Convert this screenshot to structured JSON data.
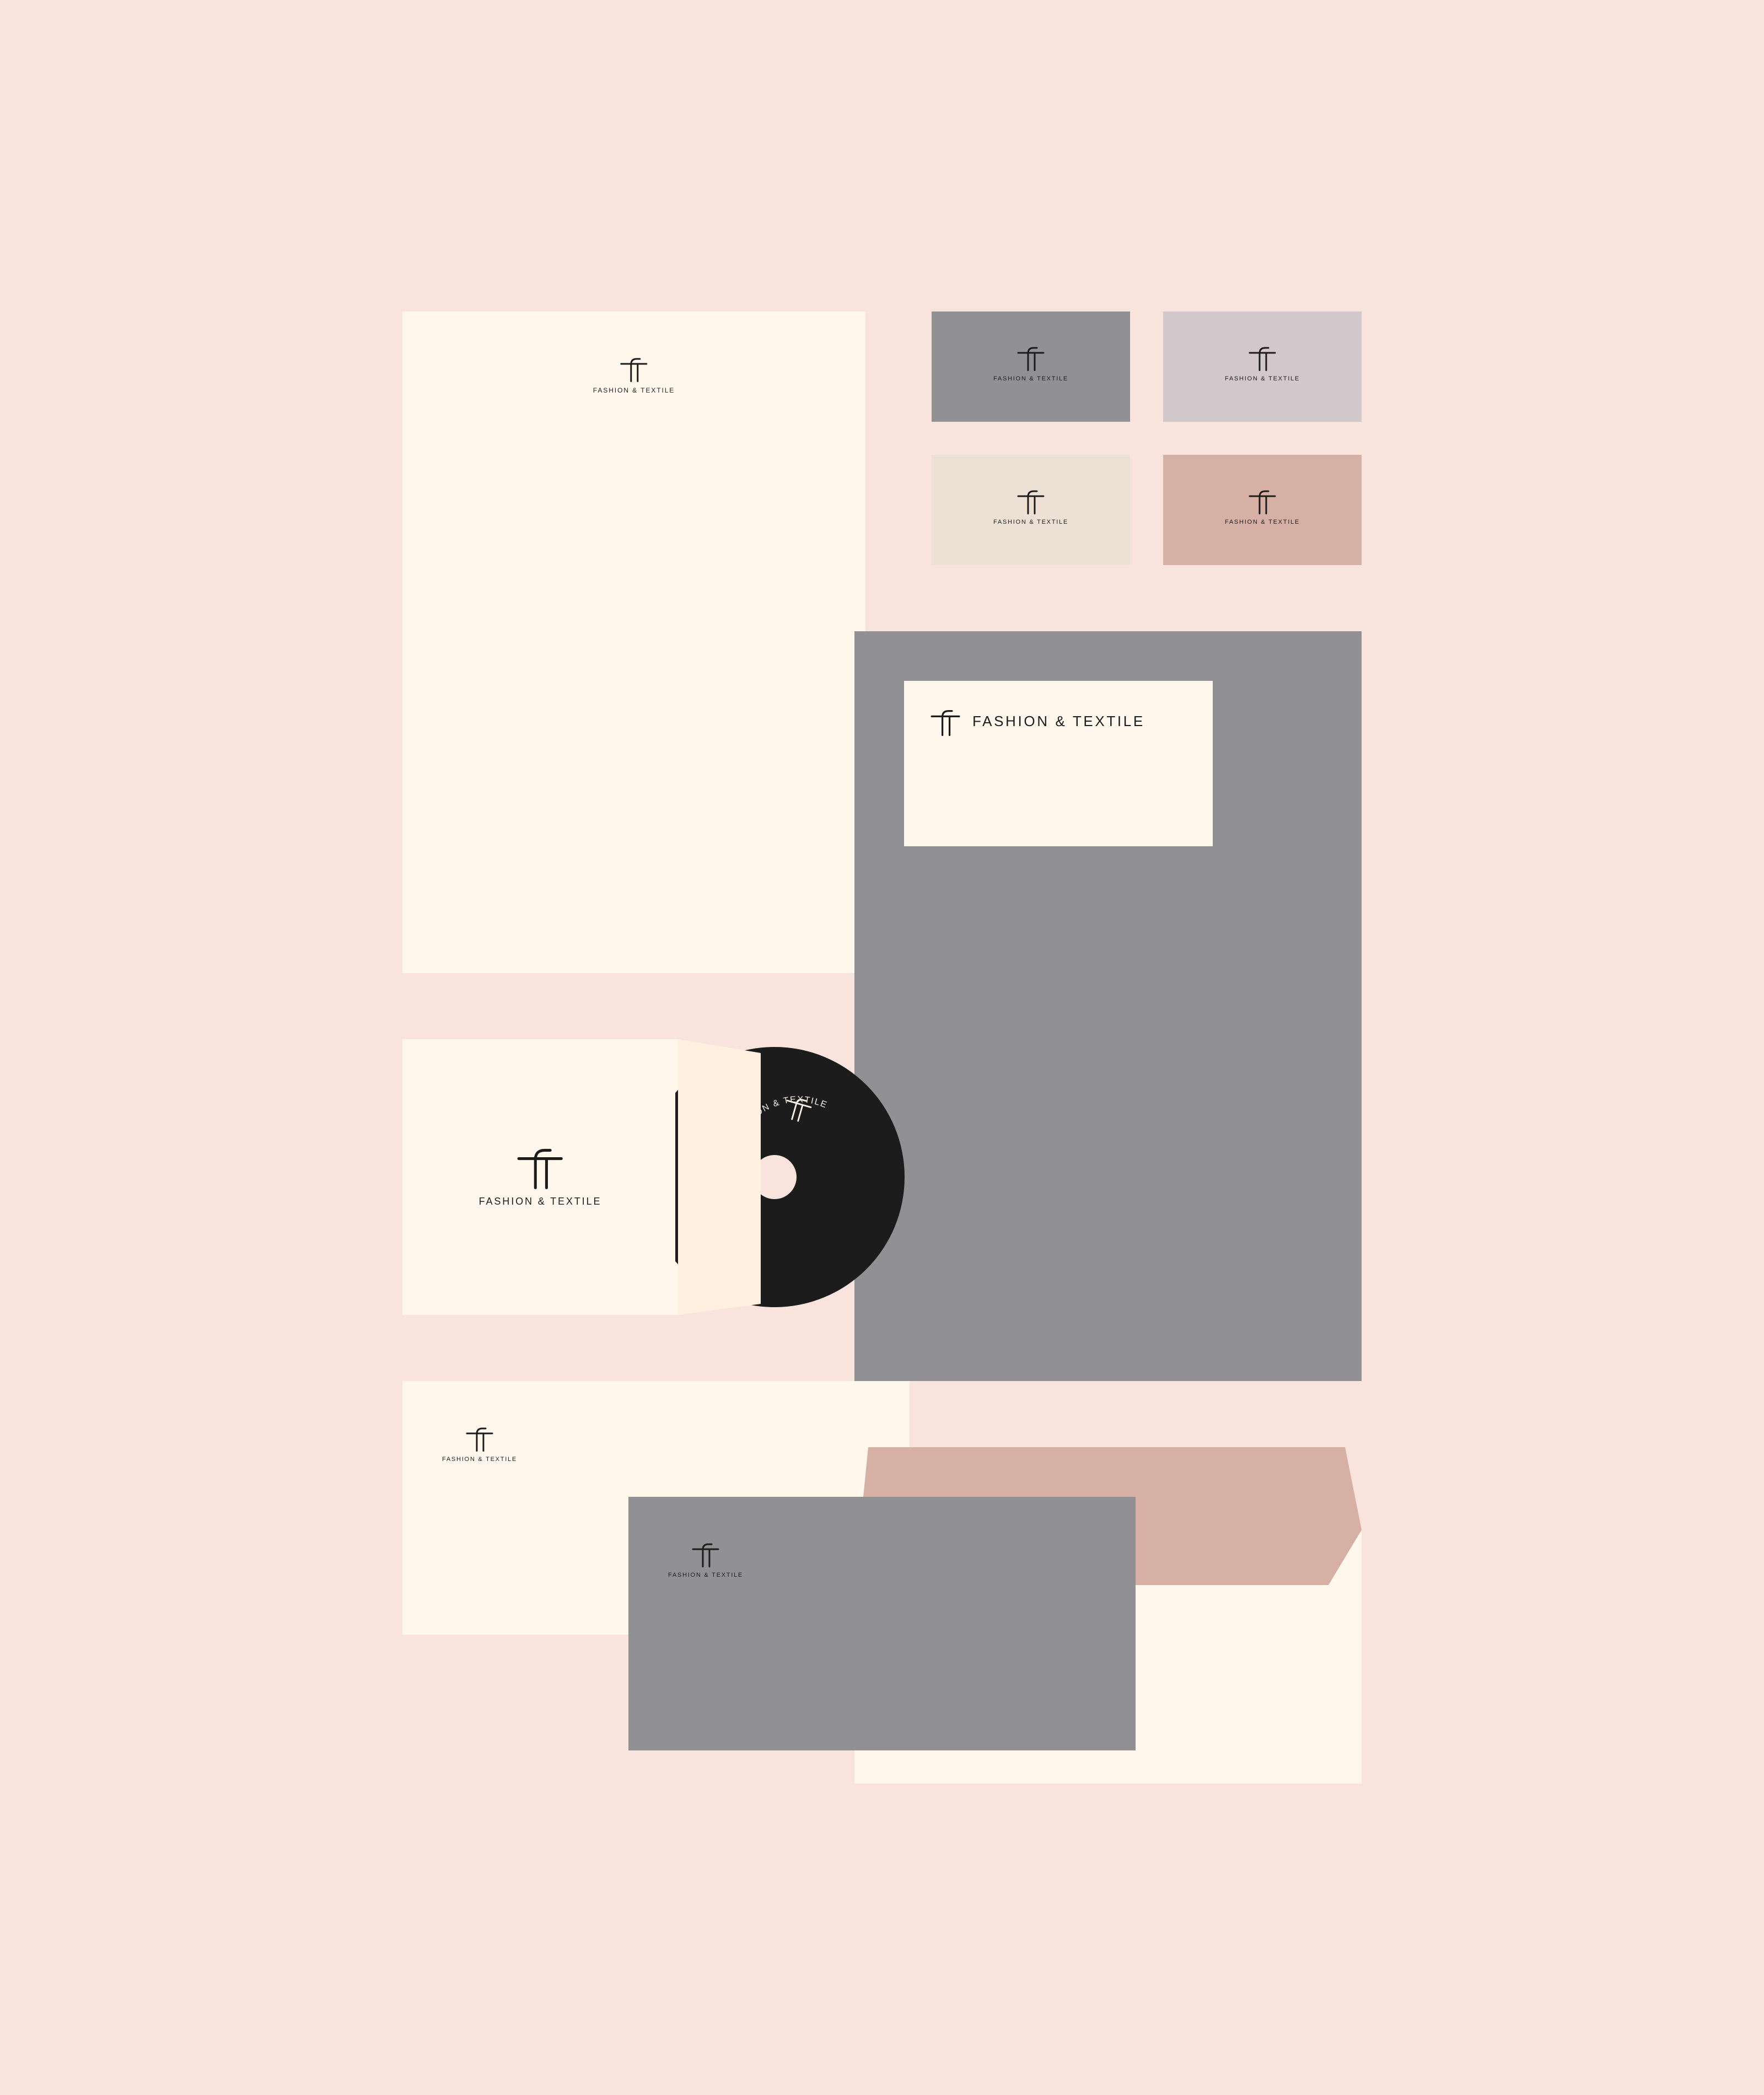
{
  "brand": {
    "name": "FASHION & TEXTILE",
    "monogram_name": "ft-monogram-icon"
  },
  "colors": {
    "background": "#f8e4dc",
    "cream": "#fff6ec",
    "cream_warm": "#fff0e0",
    "gray": "#919092",
    "lilac_gray": "#d0c8ca",
    "beige": "#ede0d5",
    "rose": "#d6b0a4",
    "ink": "#1c1c1c"
  },
  "items": {
    "letterhead": {
      "label": "FASHION & TEXTILE"
    },
    "business_cards": [
      {
        "label": "FASHION & TEXTILE",
        "color": "#919092"
      },
      {
        "label": "FASHION & TEXTILE",
        "color": "#d0c8ca"
      },
      {
        "label": "FASHION & TEXTILE",
        "color": "#ede0d5"
      },
      {
        "label": "FASHION & TEXTILE",
        "color": "#d6b0a4"
      }
    ],
    "folder": {
      "label": "FASHION & TEXTILE"
    },
    "cd_sleeve": {
      "label": "FASHION & TEXTILE"
    },
    "cd_disc": {
      "label": "FASHION & TEXTILE"
    },
    "envelope_cream": {
      "label": "FASHION & TEXTILE"
    },
    "envelope_gray": {
      "label": "FASHION & TEXTILE"
    }
  }
}
